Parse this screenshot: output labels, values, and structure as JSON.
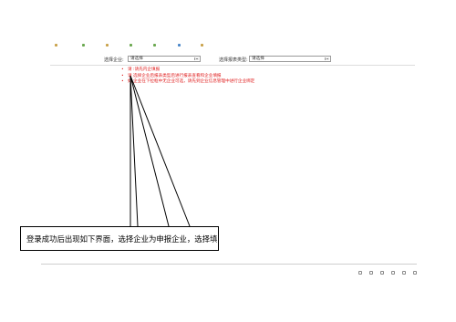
{
  "filters": {
    "enterprise": {
      "label": "选择企业:",
      "value": "请选择"
    },
    "report_type": {
      "label": "选择报表类型:",
      "value": "请选择"
    }
  },
  "notices": [
    {
      "text": "请 :请先内企填报",
      "color": "#e02020"
    },
    {
      "text": "请 选择企业后报表类型后进行报表查看和企业填报",
      "color": "#e02020"
    },
    {
      "text": "如 企业在下拉框中无企业可选，请先到企业信息管理中进行企业绑定",
      "color": "#e02020",
      "link_text": "企业信息管理中进行企业绑定"
    }
  ],
  "callout": {
    "text": "登录成功后出现如下界面，选择企业为申报企业，选择填"
  },
  "colors": {
    "notice_red": "#e02020",
    "link_blue": "#2060d0",
    "border": "#9a9a9a"
  }
}
